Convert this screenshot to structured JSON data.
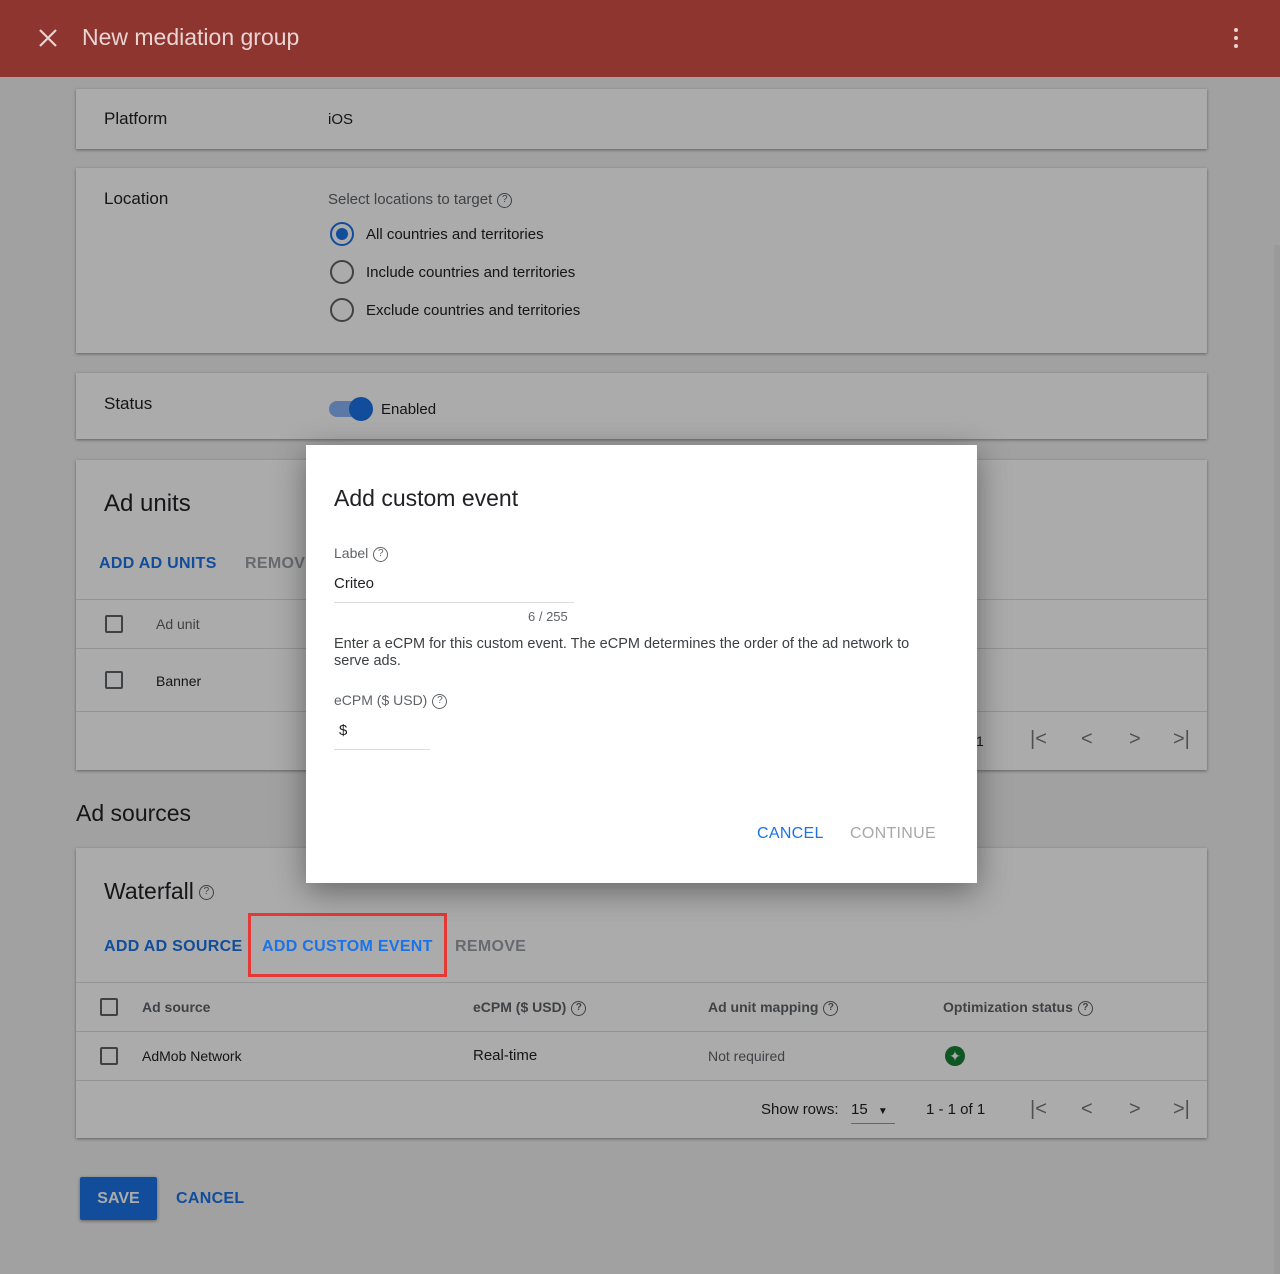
{
  "header": {
    "title": "New mediation group"
  },
  "platform": {
    "label": "Platform",
    "value": "iOS"
  },
  "location": {
    "label": "Location",
    "hint": "Select locations to target",
    "options": [
      "All countries and territories",
      "Include countries and territories",
      "Exclude countries and territories"
    ],
    "selected": 0
  },
  "status": {
    "label": "Status",
    "value": "Enabled",
    "enabled": true
  },
  "ad_units": {
    "title": "Ad units",
    "add": "ADD AD UNITS",
    "remove": "REMOVE",
    "header": "Ad unit",
    "rows": [
      "Banner"
    ],
    "page_suffix": "1"
  },
  "ad_sources": {
    "title": "Ad sources",
    "waterfall": "Waterfall",
    "add_source": "ADD AD SOURCE",
    "add_custom": "ADD CUSTOM EVENT",
    "remove": "REMOVE",
    "columns": [
      "Ad source",
      "eCPM ($ USD)",
      "Ad unit mapping",
      "Optimization status"
    ],
    "rows": [
      {
        "source": "AdMob Network",
        "ecpm": "Real-time",
        "mapping": "Not required"
      }
    ],
    "show_rows_label": "Show rows:",
    "show_rows": "15",
    "range": "1 - 1 of 1"
  },
  "footer": {
    "save": "SAVE",
    "cancel": "CANCEL"
  },
  "dialog": {
    "title": "Add custom event",
    "label_label": "Label",
    "label_value": "Criteo",
    "counter": "6 / 255",
    "desc": "Enter a eCPM for this custom event. The eCPM determines the order of the ad network to serve ads.",
    "ecpm_label": "eCPM ($ USD)",
    "ecpm_prefix": "$",
    "cancel": "CANCEL",
    "continue": "CONTINUE"
  },
  "colors": {
    "header": "#8f3530",
    "accent": "#1a73e8",
    "highlight": "#e53935",
    "success": "#188038"
  }
}
